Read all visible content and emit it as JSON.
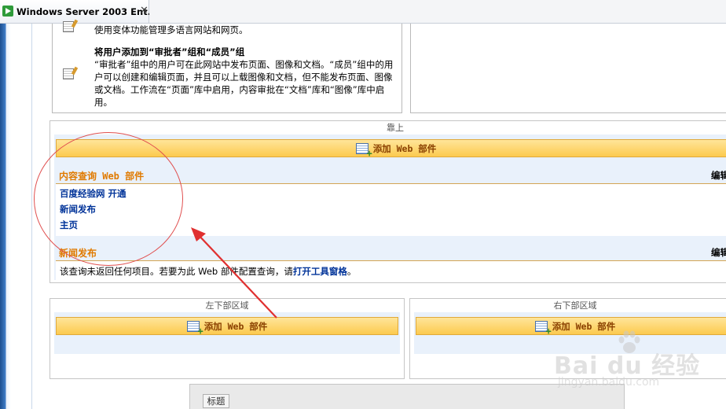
{
  "window": {
    "tab_title": "Windows Server 2003 Ent...",
    "close_glyph": "✕"
  },
  "info": {
    "item1_desc": "使用变体功能管理多语言网站和网页。",
    "item2_heading": "将用户添加到“审批者”组和“成员”组",
    "item2_desc": "“审批者”组中的用户可在此网站中发布页面、图像和文档。“成员”组中的用户可以创建和编辑页面，并且可以上载图像和文档，但不能发布页面、图像或文档。工作流在“页面”库中启用，内容审批在“文档”库和“图像”库中启用。"
  },
  "zones": {
    "top": {
      "label": "靠上",
      "add_label": "添加 Web 部件",
      "parts": [
        {
          "title": "内容查询 Web 部件",
          "edit": "编辑",
          "links": [
            "百度经验网 开通",
            "新闻发布",
            "主页"
          ]
        },
        {
          "title": "新闻发布",
          "edit": "编辑",
          "message_prefix": "该查询未返回任何项目。若要为此 Web 部件配置查询，请",
          "message_link": "打开工具窗格",
          "message_suffix": "。"
        }
      ]
    },
    "bottom_left": {
      "label": "左下部区域",
      "add_label": "添加 Web 部件"
    },
    "bottom_right": {
      "label": "右下部区域",
      "add_label": "添加 Web 部件"
    }
  },
  "bottom_panel": {
    "tag": "标题"
  },
  "watermark": {
    "logo": "Bai du 经验",
    "url": "jingyan.baidu.com"
  },
  "colors": {
    "accent_orange": "#e07a00",
    "link_blue": "#003399",
    "annotation_red": "#e03030",
    "zone_bg": "#e9f1fb"
  }
}
